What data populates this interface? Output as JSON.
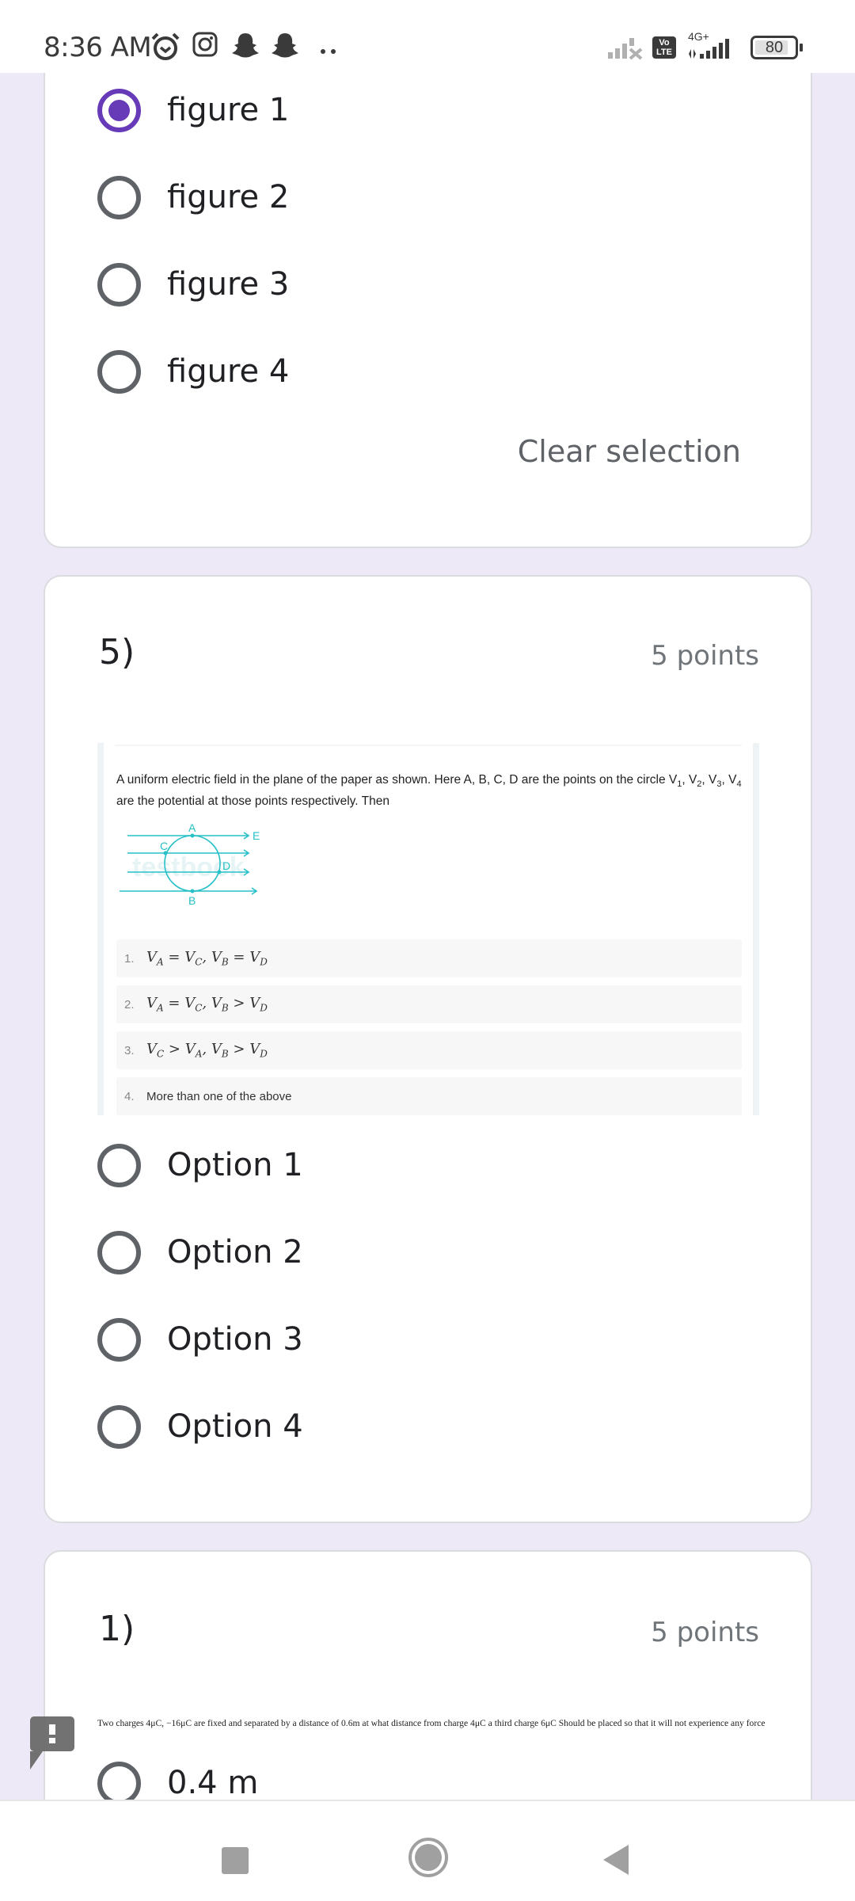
{
  "status_bar": {
    "time": "8:36 AM",
    "notification_icons": [
      "alarm-icon",
      "instagram-icon",
      "snapchat-icon",
      "snapchat-icon",
      "more-dots-icon"
    ],
    "network_label": "4G+",
    "volte_label_top": "Vo",
    "volte_label_bottom": "LTE",
    "battery_level": "80"
  },
  "question_prev": {
    "options": [
      {
        "label": "figure 1",
        "selected": true
      },
      {
        "label": "figure 2",
        "selected": false
      },
      {
        "label": "figure 3",
        "selected": false
      },
      {
        "label": "figure 4",
        "selected": false
      }
    ],
    "clear_selection_label": "Clear selection"
  },
  "question_5": {
    "number": "5)",
    "points": "5 points",
    "image": {
      "text_part1": "A uniform electric field in the plane of the paper as shown. Here A, B, C, D are the points on the circle V",
      "sub1": "1",
      "sep1": ", V",
      "sub2": "2",
      "sep2": ", V",
      "sub3": "3",
      "sep3": ", V",
      "sub4": "4",
      "text_part2": " are the potential at those points respectively. Then",
      "diagram_labels": {
        "a": "A",
        "b": "B",
        "c": "C",
        "d": "D",
        "e": "E"
      },
      "watermark": "testbook",
      "choices": [
        {
          "num": "1.",
          "math": [
            "V",
            "A",
            " = V",
            "C",
            ", V",
            "B",
            " = V",
            "D"
          ]
        },
        {
          "num": "2.",
          "math": [
            "V",
            "A",
            " = V",
            "C",
            ", V",
            "B",
            " > V",
            "D"
          ]
        },
        {
          "num": "3.",
          "math": [
            "V",
            "C",
            " > V",
            "A",
            ", V",
            "B",
            " > V",
            "D"
          ]
        },
        {
          "num": "4.",
          "text": "More than one of the above"
        }
      ]
    },
    "options": [
      {
        "label": "Option 1",
        "selected": false
      },
      {
        "label": "Option 2",
        "selected": false
      },
      {
        "label": "Option 3",
        "selected": false
      },
      {
        "label": "Option 4",
        "selected": false
      }
    ]
  },
  "question_1": {
    "number": "1)",
    "points": "5 points",
    "text": "Two charges 4μC, −16μC are fixed and separated by a distance of 0.6m  at what distance from charge 4μC a third charge 6μC Should be placed so that it will not experience any force",
    "options": [
      {
        "label": "0.4 m",
        "selected": false
      }
    ]
  },
  "colors": {
    "accent": "#673ab7",
    "page_bg": "#ede9f6",
    "diagram": "#26c0c7"
  }
}
